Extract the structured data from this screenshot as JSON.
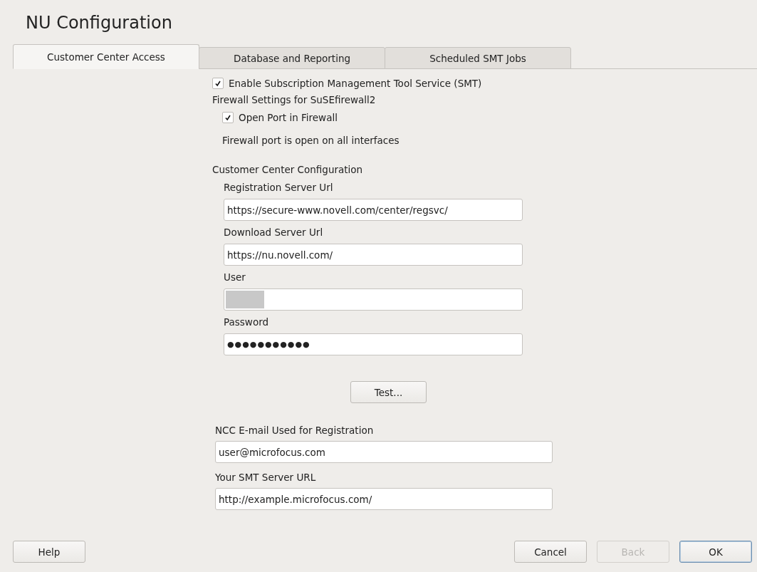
{
  "title": "NU Configuration",
  "tabs": [
    {
      "label": "Customer Center Access",
      "selected": true
    },
    {
      "label": "Database and Reporting",
      "selected": false
    },
    {
      "label": "Scheduled SMT Jobs",
      "selected": false
    }
  ],
  "enable_smt": {
    "label": "Enable Subscription Management Tool Service (SMT)",
    "checked": true
  },
  "firewall": {
    "heading": "Firewall Settings for SuSEfirewall2",
    "open_port": {
      "label": "Open Port in Firewall",
      "checked": true
    },
    "status": "Firewall port is open on all interfaces"
  },
  "customer_center": {
    "heading": "Customer Center Configuration",
    "fields": [
      {
        "label": "Registration Server Url",
        "value": "https://secure-www.novell.com/center/regsvc/",
        "redacted": false
      },
      {
        "label": "Download Server Url",
        "value": "https://nu.novell.com/",
        "redacted": false
      },
      {
        "label": "User",
        "redacted": true
      },
      {
        "label": "Password",
        "value": "●●●●●●●●●●●",
        "redacted": false
      }
    ]
  },
  "test_button": "Test...",
  "extra_fields": [
    {
      "label": "NCC E-mail Used for Registration",
      "value": "user@microfocus.com"
    },
    {
      "label": "Your SMT Server URL",
      "value": "http://example.microfocus.com/"
    }
  ],
  "buttons": {
    "help": {
      "label": "Help",
      "disabled": false
    },
    "cancel": {
      "label": "Cancel",
      "disabled": false
    },
    "back": {
      "label": "Back",
      "disabled": true
    },
    "ok": {
      "label": "OK",
      "disabled": false,
      "default": true
    }
  }
}
